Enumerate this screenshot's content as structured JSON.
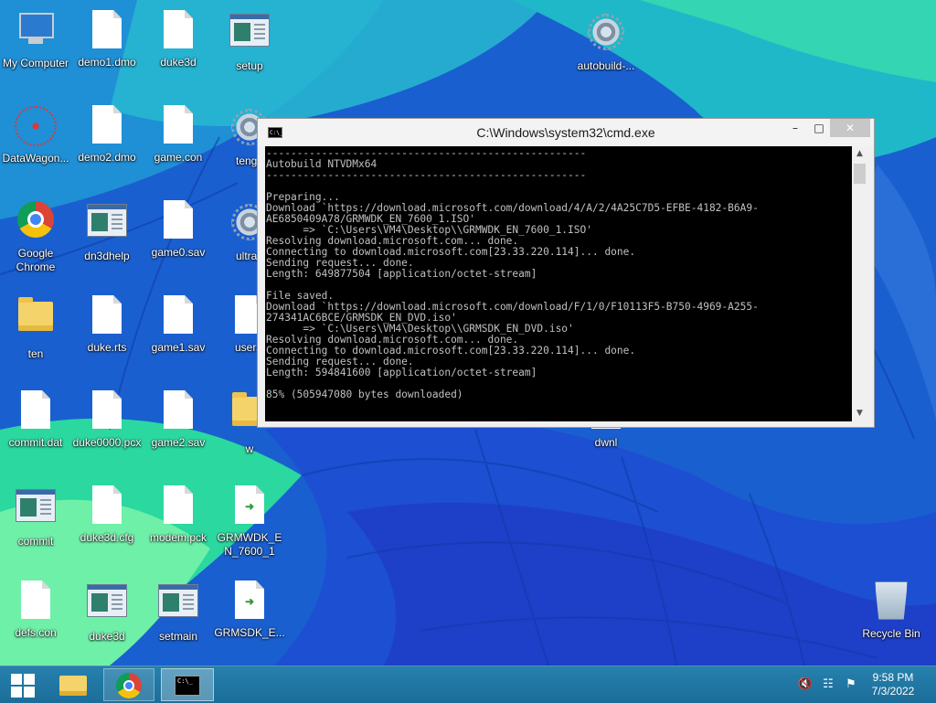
{
  "desktop": {
    "icons": [
      {
        "label": "My Computer",
        "kind": "computer-icon"
      },
      {
        "label": "demo1.dmo",
        "kind": "file-icon"
      },
      {
        "label": "duke3d",
        "kind": "file-icon"
      },
      {
        "label": "setup",
        "kind": "setup-icon"
      },
      {
        "label": "autobuild-...",
        "kind": "gear-file-icon"
      },
      {
        "label": "DataWagon...",
        "kind": "molecule-icon"
      },
      {
        "label": "demo2.dmo",
        "kind": "file-icon"
      },
      {
        "label": "game.con",
        "kind": "file-icon"
      },
      {
        "label": "tenga",
        "kind": "gear-file-icon"
      },
      {
        "label": "Google Chrome",
        "kind": "chrome-icon"
      },
      {
        "label": "dn3dhelp",
        "kind": "app-window-icon"
      },
      {
        "label": "game0.sav",
        "kind": "file-icon"
      },
      {
        "label": "ultran",
        "kind": "gear-file-icon"
      },
      {
        "label": "ten",
        "kind": "folder-icon"
      },
      {
        "label": "duke.rts",
        "kind": "file-icon"
      },
      {
        "label": "game1.sav",
        "kind": "file-icon"
      },
      {
        "label": "user.c",
        "kind": "file-icon"
      },
      {
        "label": "commit.dat",
        "kind": "file-icon"
      },
      {
        "label": "duke0000.pcx",
        "kind": "file-icon"
      },
      {
        "label": "game2.sav",
        "kind": "file-icon"
      },
      {
        "label": "w",
        "kind": "folder-icon"
      },
      {
        "label": "dwnl",
        "kind": "file-icon"
      },
      {
        "label": "commit",
        "kind": "app-window-icon"
      },
      {
        "label": "duke3d.cfg",
        "kind": "file-icon"
      },
      {
        "label": "modem.pck",
        "kind": "file-icon"
      },
      {
        "label": "GRMWDK_EN_7600_1",
        "kind": "package-file-icon"
      },
      {
        "label": "defs.con",
        "kind": "file-icon"
      },
      {
        "label": "duke3d",
        "kind": "app-window-icon"
      },
      {
        "label": "setmain",
        "kind": "app-window-icon"
      },
      {
        "label": "GRMSDK_E...",
        "kind": "package-file-icon"
      },
      {
        "label": "Recycle Bin",
        "kind": "recycle-bin-icon"
      }
    ]
  },
  "cmd_window": {
    "title": "C:\\Windows\\system32\\cmd.exe",
    "title_icon_text": "C:\\_",
    "min_glyph": "–",
    "max_glyph": "□",
    "close_glyph": "✕",
    "console_lines": [
      "----------------------------------------------------",
      "Autobuild NTVDMx64",
      "----------------------------------------------------",
      "",
      "Preparing...",
      "Download `https://download.microsoft.com/download/4/A/2/4A25C7D5-EFBE-4182-B6A9-",
      "AE6850409A78/GRMWDK_EN_7600_1.ISO'",
      "      => `C:\\Users\\VM4\\Desktop\\\\GRMWDK_EN_7600_1.ISO'",
      "Resolving download.microsoft.com... done.",
      "Connecting to download.microsoft.com[23.33.220.114]... done.",
      "Sending request... done.",
      "Length: 649877504 [application/octet-stream]",
      "",
      "File saved.",
      "Download `https://download.microsoft.com/download/F/1/0/F10113F5-B750-4969-A255-",
      "274341AC6BCE/GRMSDK_EN_DVD.iso'",
      "      => `C:\\Users\\VM4\\Desktop\\\\GRMSDK_EN_DVD.iso'",
      "Resolving download.microsoft.com... done.",
      "Connecting to download.microsoft.com[23.33.220.114]... done.",
      "Sending request... done.",
      "Length: 594841600 [application/octet-stream]",
      "",
      "85% (505947080 bytes downloaded)"
    ],
    "scroll_up_glyph": "▲",
    "scroll_down_glyph": "▼"
  },
  "taskbar": {
    "cmd_icon_text": "C:\\_",
    "tray": {
      "volume": "🔇",
      "network": "☷",
      "flag": "⚑"
    },
    "clock": {
      "time": "9:58 PM",
      "date": "7/3/2022"
    }
  },
  "colors": {
    "wallpaper_blue": "#1565d0",
    "wallpaper_teal": "#2bc8b5",
    "wallpaper_green": "#5ef0a0",
    "taskbar": "#1c6e96"
  }
}
